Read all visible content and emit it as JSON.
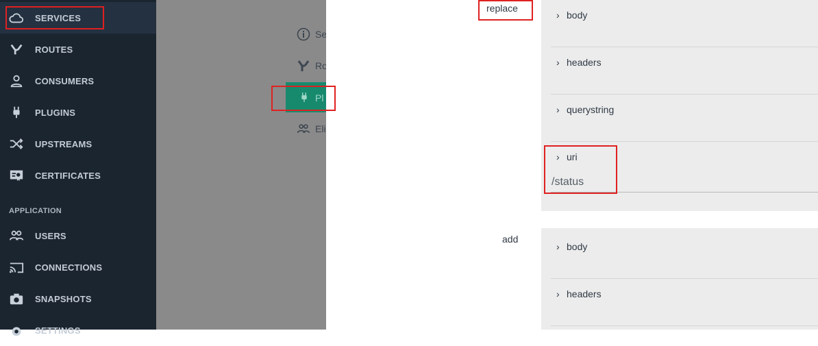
{
  "sidebar": {
    "items": [
      {
        "label": "SERVICES",
        "icon": "cloud-icon"
      },
      {
        "label": "ROUTES",
        "icon": "routes-icon"
      },
      {
        "label": "CONSUMERS",
        "icon": "user-icon"
      },
      {
        "label": "PLUGINS",
        "icon": "plug-icon"
      },
      {
        "label": "UPSTREAMS",
        "icon": "shuffle-icon"
      },
      {
        "label": "CERTIFICATES",
        "icon": "certificate-icon"
      }
    ],
    "section": "APPLICATION",
    "app_items": [
      {
        "label": "USERS",
        "icon": "users-icon"
      },
      {
        "label": "CONNECTIONS",
        "icon": "cast-icon"
      },
      {
        "label": "SNAPSHOTS",
        "icon": "camera-icon"
      },
      {
        "label": "SETTINGS",
        "icon": "gear-icon"
      }
    ]
  },
  "background_nav": {
    "items": [
      {
        "label": "Se",
        "icon": "info-icon"
      },
      {
        "label": "Ro",
        "icon": "routes-icon"
      },
      {
        "label": "Pl",
        "icon": "plug-icon"
      },
      {
        "label": "Eli",
        "icon": "users-icon"
      }
    ]
  },
  "form": {
    "replace": {
      "label": "replace",
      "fields": [
        "body",
        "headers",
        "querystring",
        "uri"
      ],
      "uri_value": "/status"
    },
    "add": {
      "label": "add",
      "fields": [
        "body",
        "headers"
      ]
    }
  },
  "colors": {
    "sidebar_bg": "#1b2530",
    "accent": "#178a6e",
    "highlight": "#e02020"
  }
}
